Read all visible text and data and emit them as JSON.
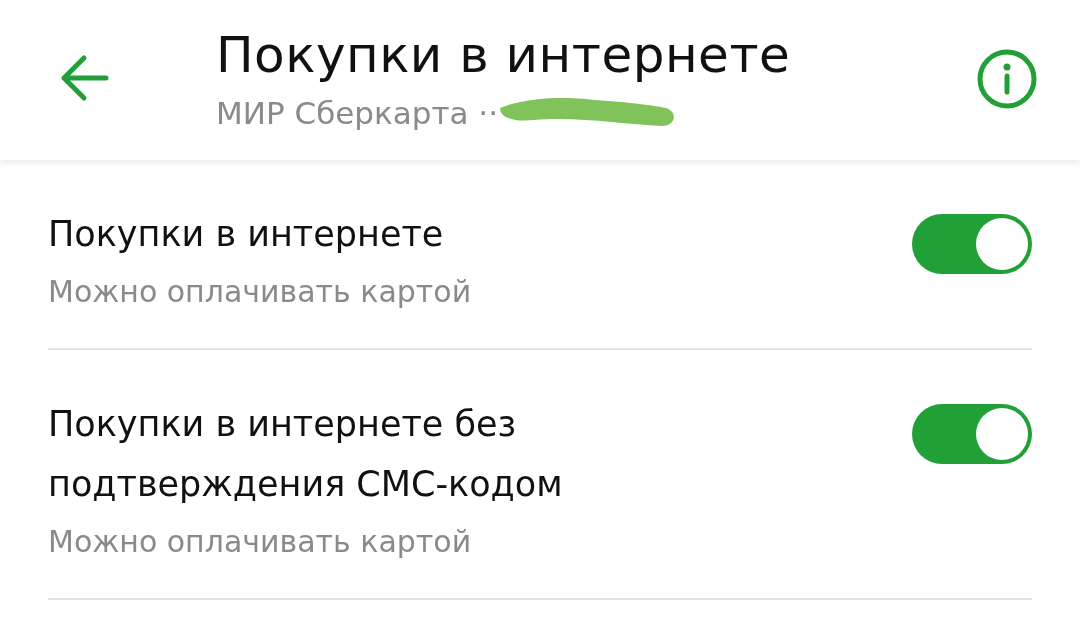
{
  "header": {
    "title": "Покупки в интернете",
    "subtitle": "МИР Сберкарта ··"
  },
  "settings": [
    {
      "title": "Покупки в интернете",
      "description": "Можно оплачивать картой",
      "on": true
    },
    {
      "title": "Покупки в интернете без подтверждения СМС-кодом",
      "description": "Можно оплачивать картой",
      "on": true
    }
  ]
}
